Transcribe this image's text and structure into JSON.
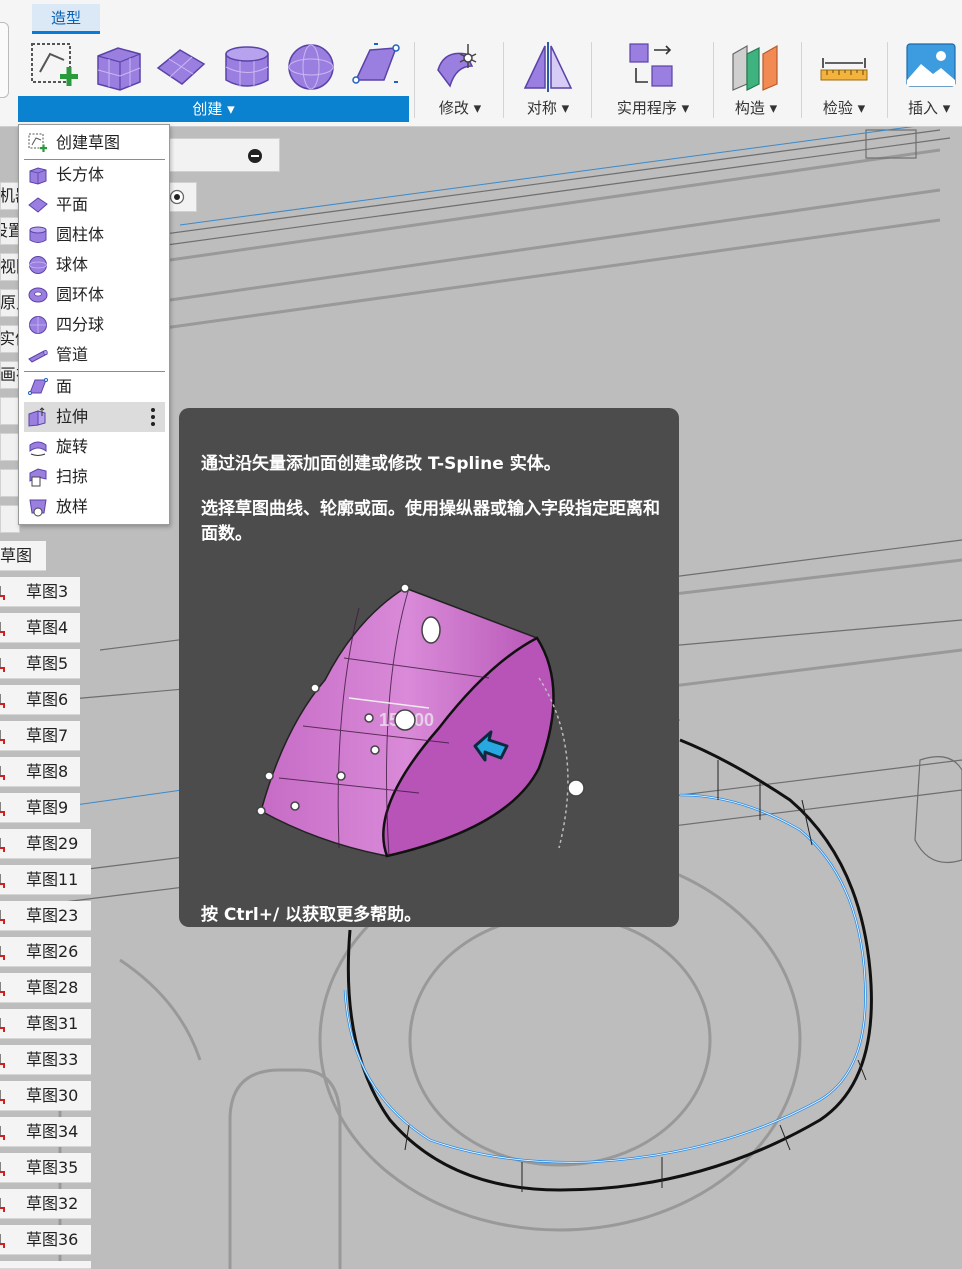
{
  "toolbar": {
    "active_tab": "造型",
    "groups": {
      "create": "创建",
      "modify": "修改",
      "symmetry": "对称",
      "utilities": "实用程序",
      "construct": "构造",
      "inspect": "检验",
      "insert": "插入"
    },
    "colors": {
      "accent": "#0A82D0",
      "tspline_purple": "#9B7FE0"
    }
  },
  "create_menu": {
    "items": [
      {
        "label": "创建草图",
        "icon": "create-sketch-icon"
      },
      {
        "label": "长方体",
        "icon": "box-icon"
      },
      {
        "label": "平面",
        "icon": "plane-icon"
      },
      {
        "label": "圆柱体",
        "icon": "cylinder-icon"
      },
      {
        "label": "球体",
        "icon": "sphere-icon"
      },
      {
        "label": "圆环体",
        "icon": "torus-icon"
      },
      {
        "label": "四分球",
        "icon": "quadball-icon"
      },
      {
        "label": "管道",
        "icon": "pipe-icon"
      },
      {
        "label": "面",
        "icon": "face-icon"
      },
      {
        "label": "拉伸",
        "icon": "extrude-icon",
        "highlighted": true
      },
      {
        "label": "旋转",
        "icon": "revolve-icon"
      },
      {
        "label": "扫掠",
        "icon": "sweep-icon"
      },
      {
        "label": "放样",
        "icon": "loft-icon"
      }
    ]
  },
  "browser": {
    "cut_labels": [
      "机器",
      "设置",
      "视图",
      "原点",
      "实体",
      "画布"
    ],
    "sketches_folder": "草图",
    "sketches": [
      "草图3",
      "草图4",
      "草图5",
      "草图6",
      "草图7",
      "草图8",
      "草图9",
      "草图29",
      "草图11",
      "草图23",
      "草图26",
      "草图28",
      "草图31",
      "草图33",
      "草图30",
      "草图34",
      "草图35",
      "草图32",
      "草图36"
    ]
  },
  "tooltip": {
    "line1": "通过沿矢量添加面创建或修改 T-Spline 实体。",
    "line2": "选择草图曲线、轮廓或面。使用操纵器或输入字段指定距离和面数。",
    "illustration_value": "150.00",
    "footer": "按 Ctrl+/ 以获取更多帮助。"
  }
}
